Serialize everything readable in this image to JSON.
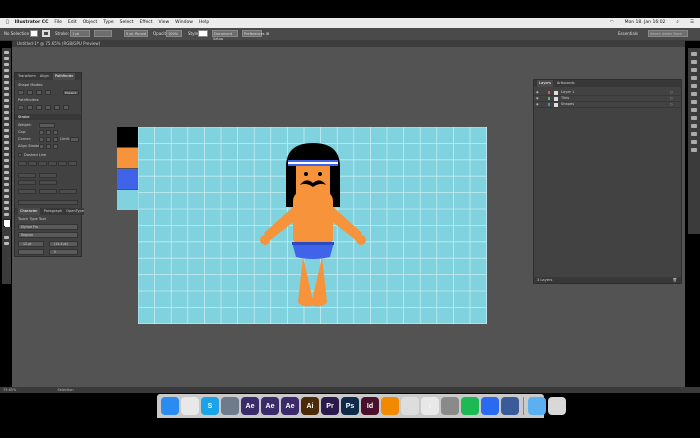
{
  "menubar": {
    "apple": "",
    "items": [
      "Illustrator CC",
      "File",
      "Edit",
      "Object",
      "Type",
      "Select",
      "Effect",
      "View",
      "Window",
      "Help"
    ],
    "clock": "Mon 18. Jan 16:02"
  },
  "control_bar": {
    "selection_label": "No Selection",
    "stroke_label": "Stroke:",
    "stroke_width": "1 pt",
    "brush_label": "5 pt. Round",
    "opacity_label": "Opacity:",
    "opacity_value": "100%",
    "style_label": "Style:",
    "doc_setup": "Document Setup",
    "preferences": "Preferences",
    "workspace": "Essentials",
    "search_placeholder": "Search Adobe Stock"
  },
  "document_tab": {
    "title": "Untitled-1* @ 75.65% (RGB/GPU Preview)"
  },
  "left_panel": {
    "tabs": [
      "Transform",
      "Align",
      "Pathfinder"
    ],
    "active_tab": "Pathfinder",
    "shape_modes_label": "Shape Modes:",
    "expand_label": "Expand",
    "pathfinders_label": "Pathfinders:",
    "stroke_section_label": "Stroke",
    "weight_label": "Weight:",
    "cap_label": "Cap:",
    "corner_label": "Corner:",
    "limit_label": "Limit:",
    "align_stroke_label": "Align Stroke:",
    "dashed_line_label": "Dashed Line",
    "char_tabs": [
      "Character",
      "Paragraph",
      "OpenType"
    ],
    "touch_type_label": "Touch Type Tool",
    "font_name": "Myriad Pro",
    "font_style": "Regular",
    "font_size": "12 pt",
    "leading": "(14.4 pt)",
    "tracking": "0"
  },
  "layers_panel": {
    "tabs": [
      "Layers",
      "Artboards"
    ],
    "active_tab": "Layers",
    "layers": [
      {
        "name": "Layer 1",
        "color": "#e05050"
      },
      {
        "name": "Tiles",
        "color": "#50c050"
      },
      {
        "name": "Shapes",
        "color": "#5080e0"
      }
    ],
    "footer": "3 Layers"
  },
  "swatches": [
    "#000000",
    "#f7933a",
    "#3f64ea",
    "#7fd2de"
  ],
  "artboard": {
    "background": "#7fd2de",
    "grid_color": "#c8ecf1"
  },
  "statusbar": {
    "zoom": "75.65%",
    "tool": "Selection"
  },
  "dock": {
    "apps": [
      {
        "name": "Finder",
        "label": "",
        "color": "#2a8cf0"
      },
      {
        "name": "Chrome",
        "label": "",
        "color": "#e8e8e8"
      },
      {
        "name": "Skype",
        "label": "S",
        "color": "#1aa3e8"
      },
      {
        "name": "Launchpad",
        "label": "",
        "color": "#6f7a8a"
      },
      {
        "name": "After Effects",
        "label": "Ae",
        "color": "#3b2b6b"
      },
      {
        "name": "After Effects 2",
        "label": "Ae",
        "color": "#3b2b6b"
      },
      {
        "name": "After Effects 3",
        "label": "Ae",
        "color": "#3b2b6b"
      },
      {
        "name": "Illustrator",
        "label": "Ai",
        "color": "#4a2a07"
      },
      {
        "name": "Premiere",
        "label": "Pr",
        "color": "#2b1a4b"
      },
      {
        "name": "Photoshop",
        "label": "Ps",
        "color": "#0f2b4a"
      },
      {
        "name": "InDesign",
        "label": "Id",
        "color": "#4a0f2b"
      },
      {
        "name": "VLC",
        "label": "",
        "color": "#f18a00"
      },
      {
        "name": "Photos",
        "label": "",
        "color": "#ddd"
      },
      {
        "name": "iTunes",
        "label": "♪",
        "color": "#e8e8e8"
      },
      {
        "name": "System Preferences",
        "label": "",
        "color": "#8a8a8a"
      },
      {
        "name": "Spotify",
        "label": "",
        "color": "#1db954"
      },
      {
        "name": "Safari",
        "label": "",
        "color": "#2a6af0"
      },
      {
        "name": "Browser",
        "label": "",
        "color": "#3a5a9a"
      },
      {
        "name": "Downloads",
        "label": "",
        "color": "#5ab0f0"
      },
      {
        "name": "Trash",
        "label": "",
        "color": "#d8d8d8"
      }
    ]
  }
}
